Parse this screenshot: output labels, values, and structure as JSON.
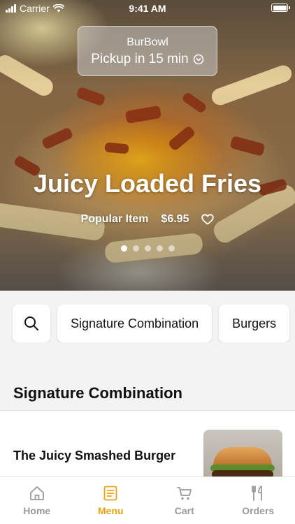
{
  "status_bar": {
    "carrier": "Carrier",
    "time": "9:41 AM"
  },
  "pickup": {
    "restaurant": "BurBowl",
    "label": "Pickup in 15 min"
  },
  "hero": {
    "title": "Juicy Loaded Fries",
    "tag": "Popular Item",
    "price": "$6.95",
    "page_count": 5,
    "active_page": 1
  },
  "categories": {
    "search_icon": "search-icon",
    "items": [
      "Signature Combination",
      "Burgers"
    ]
  },
  "section": {
    "title": "Signature Combination"
  },
  "menu_items": [
    {
      "name": "The Juicy Smashed Burger"
    }
  ],
  "tab_bar": {
    "tabs": [
      {
        "label": "Home",
        "icon": "home-icon"
      },
      {
        "label": "Menu",
        "icon": "menu-icon"
      },
      {
        "label": "Cart",
        "icon": "cart-icon"
      },
      {
        "label": "Orders",
        "icon": "orders-icon"
      }
    ],
    "active": "Menu",
    "active_color": "#e7a413",
    "inactive_color": "#9a9a9a"
  }
}
